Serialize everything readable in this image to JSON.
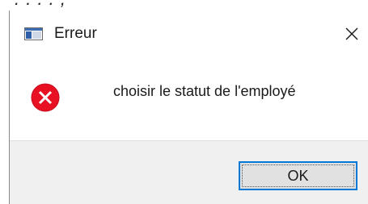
{
  "dialog": {
    "title": "Erreur",
    "message": "choisir le statut de l'employé",
    "ok_label": "OK",
    "icons": {
      "app": "app-window-icon",
      "close": "close-icon",
      "status": "error-icon"
    },
    "colors": {
      "error_red": "#e81123",
      "button_border": "#0078d7",
      "button_bg": "#e1e1e1",
      "footer_bg": "#f0f0f0"
    }
  }
}
